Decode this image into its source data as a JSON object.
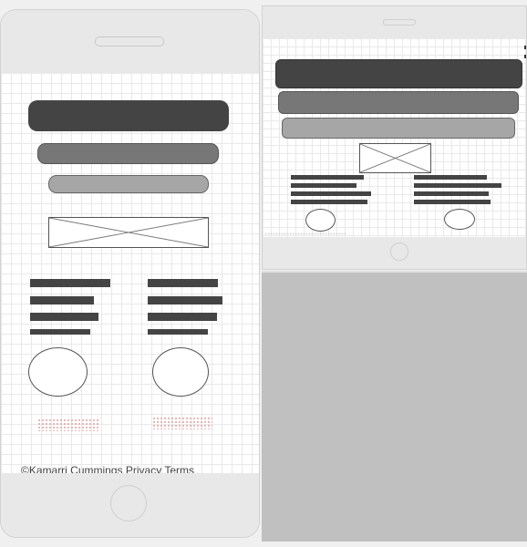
{
  "colors": {
    "bar_dark": "#444444",
    "bar_medium": "#777777",
    "bar_light": "#a6a6a6",
    "bezel": "#e8e8e8",
    "panel_gray": "#c0c0c0",
    "placeholder_dots": "#e2a0a0"
  },
  "icons": {
    "image_placeholder": "image-placeholder-icon",
    "home_button": "home-button-icon",
    "menu": "menu-icon"
  },
  "footer": {
    "text": "©Kamarri Cummings Privacy Terms"
  }
}
